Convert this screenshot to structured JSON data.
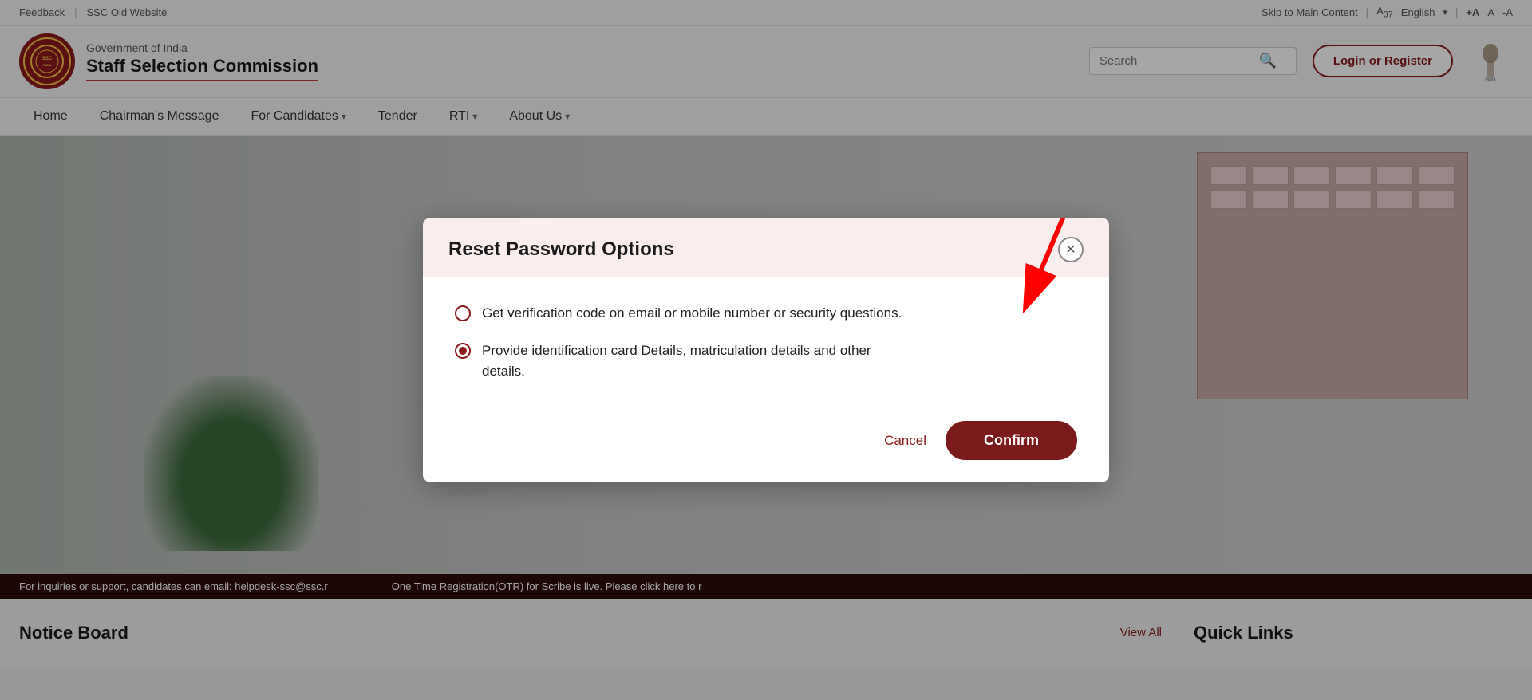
{
  "topbar": {
    "feedback": "Feedback",
    "separator1": "|",
    "old_website": "SSC Old Website",
    "skip": "Skip to Main Content",
    "separator2": "|",
    "font_label": "A",
    "font_subscript": "37",
    "language": "English",
    "separator3": "|",
    "font_plus": "+A",
    "font_normal": "A",
    "font_minus": "-A"
  },
  "header": {
    "gov_line": "Government of India",
    "ssc_name": "Staff Selection Commission",
    "search_placeholder": "Search",
    "login_label": "Login or Register"
  },
  "nav": {
    "items": [
      {
        "label": "Home",
        "has_dropdown": false
      },
      {
        "label": "Chairman's Message",
        "has_dropdown": false
      },
      {
        "label": "For Candidates",
        "has_dropdown": true
      },
      {
        "label": "Tender",
        "has_dropdown": false
      },
      {
        "label": "RTI",
        "has_dropdown": true
      },
      {
        "label": "About Us",
        "has_dropdown": true
      }
    ]
  },
  "ticker": {
    "messages": [
      "For inquiries or support, candidates can email: helpdesk-ssc@ssc.nic.in",
      "One Time Registration(OTR) for Scribe is live. Please click here to register."
    ]
  },
  "modal": {
    "title": "Reset Password Options",
    "option1": "Get verification code on email or mobile number or security questions.",
    "option2_line1": "Provide identification card Details, matriculation details and other",
    "option2_line2": "details.",
    "option1_selected": false,
    "option2_selected": true,
    "cancel_label": "Cancel",
    "confirm_label": "Confirm"
  },
  "bottom": {
    "notice_board_title": "Notice Board",
    "view_all_label": "View All",
    "quick_links_title": "Quick Links"
  }
}
